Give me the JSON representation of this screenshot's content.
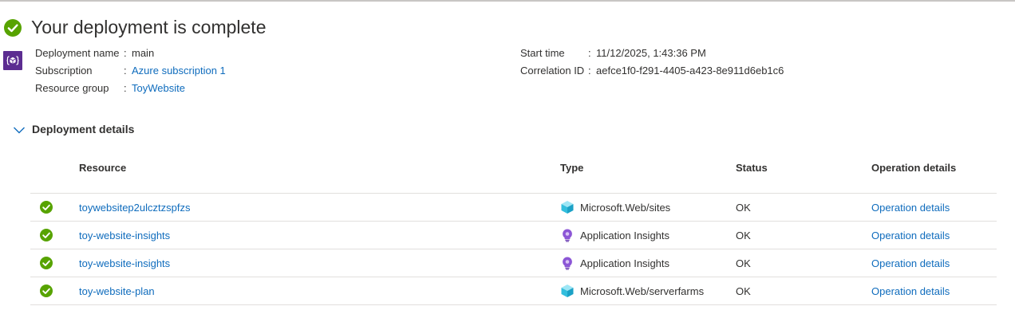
{
  "header": {
    "title": "Your deployment is complete"
  },
  "summary": {
    "deployment_name_label": "Deployment name",
    "deployment_name": "main",
    "subscription_label": "Subscription",
    "subscription": "Azure subscription 1",
    "resource_group_label": "Resource group",
    "resource_group": "ToyWebsite",
    "start_time_label": "Start time",
    "start_time": "11/12/2025, 1:43:36 PM",
    "correlation_id_label": "Correlation ID",
    "correlation_id": "aefce1f0-f291-4405-a423-8e911d6eb1c6",
    "separator": ":"
  },
  "details": {
    "label": "Deployment details",
    "columns": {
      "resource": "Resource",
      "type": "Type",
      "status": "Status",
      "operation": "Operation details"
    },
    "rows": [
      {
        "resource": "toywebsitep2ulcztzspfzs",
        "type": "Microsoft.Web/sites",
        "type_icon": "web-sites-icon",
        "status": "OK",
        "operation": "Operation details"
      },
      {
        "resource": "toy-website-insights",
        "type": "Application Insights",
        "type_icon": "application-insights-icon",
        "status": "OK",
        "operation": "Operation details"
      },
      {
        "resource": "toy-website-insights",
        "type": "Application Insights",
        "type_icon": "application-insights-icon",
        "status": "OK",
        "operation": "Operation details"
      },
      {
        "resource": "toy-website-plan",
        "type": "Microsoft.Web/serverfarms",
        "type_icon": "server-farms-icon",
        "status": "OK",
        "operation": "Operation details"
      }
    ]
  },
  "colors": {
    "success": "#57a300",
    "link": "#0f6cbd",
    "deploy_icon_bg": "#5c2d91",
    "insights_purple": "#8c56d6",
    "web_cyan": "#32bedd"
  }
}
